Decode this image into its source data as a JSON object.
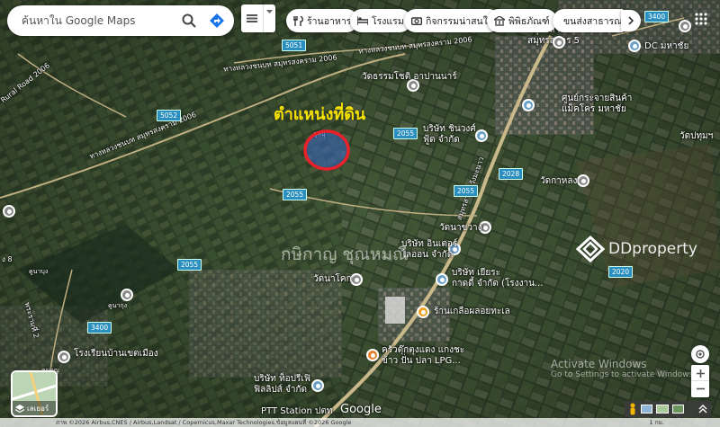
{
  "search": {
    "placeholder": "ค้นหาใน Google Maps"
  },
  "chips": [
    {
      "label": "ร้านอาหาร",
      "icon": "fork-knife-icon"
    },
    {
      "label": "โรงแรม",
      "icon": "bed-icon"
    },
    {
      "label": "กิจกรรมน่าสนใจ",
      "icon": "camera-icon"
    },
    {
      "label": "พิพิธภัณฑ์",
      "icon": "museum-icon"
    },
    {
      "label": "ขนส่งสาธารณ",
      "icon": "bus-icon"
    }
  ],
  "annotation": {
    "title": "ตำแหน่งที่ดิน",
    "circle_color": "#e8212b",
    "title_color": "#f5e200"
  },
  "watermark": {
    "brand": "DDproperty",
    "overlay_text": "กษิกาญ ชุณหมณี"
  },
  "roads": {
    "rural_road": "Rural Road 2006",
    "road_2006_a": "ทางหลวงชนบท สมุทรสงคราม 2006",
    "road_2006_b": "ทางหลวงชนบท สมุทรสงคราม 2006",
    "road_2006_c": "ทางหลวงชนบท สมุทรสงคราม 2006",
    "road_35": "สมุทรสาคร-วังมะนาว",
    "road_35b": "พระรามที่ 2",
    "road_8": "ง 8"
  },
  "shields": [
    "5051",
    "5052",
    "2055",
    "2055",
    "2055",
    "2055",
    "2028",
    "2020",
    "3400",
    "3400"
  ],
  "places": [
    {
      "name": "วัดธรรมโชติ\nอาปานนาร์"
    },
    {
      "name": "บริษัท ชินวงศ์\nฟู้ด จำกัด"
    },
    {
      "name": "DC มหาชัย"
    },
    {
      "name": "ศูนย์กระจายสินค้า\nแม็คโคร มหาชัย"
    },
    {
      "name": "วัดปทุมฯ"
    },
    {
      "name": "วัดกาหลง"
    },
    {
      "name": "วัดนาขวาง"
    },
    {
      "name": "บริษัท อินเตอร์\nไลออน จำกัด"
    },
    {
      "name": "บริษัท เยียระ\nกาดดี้ จำกัด (โรงงาน..."
    },
    {
      "name": "วัดนาโคก"
    },
    {
      "name": "ร้านเกลือผลอยทะเล"
    },
    {
      "name": "ครัวตุ๊กตุงแดง แกงชะ\nข้าว ปั่น ปลา LPG..."
    },
    {
      "name": "โรงเรียนบ้านเขตเมือง"
    },
    {
      "name": "บริษัท ท็อปรีเฟิ\nฟิลลิปส์ จำกัด"
    },
    {
      "name": "PTT Station ปตท"
    },
    {
      "name": "สมุทรสาคร 5"
    },
    {
      "name": "สมุทรสาคร"
    },
    {
      "name": "คูนากุง"
    },
    {
      "name": "คูนกุญ"
    },
    {
      "name": "คูนาบุง"
    },
    {
      "name": "คูลบุ"
    }
  ],
  "google_logo": "Google",
  "layers_label": "เลเยอร์",
  "activate_windows": {
    "title": "Activate Windows",
    "subtitle": "Go to Settings to activate Windows."
  },
  "footer": "ภาพ ©2026 Airbus,CNES / Airbus,Landsat / Copernicus,Maxar Technologies,ข้อมูลแผนที่ ©2026 Google",
  "scale": "1 กม."
}
